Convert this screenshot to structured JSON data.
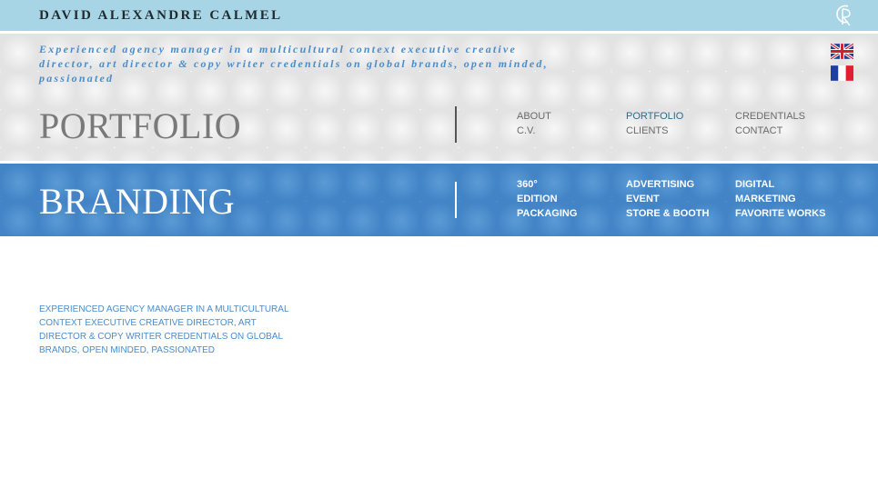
{
  "topbar": {
    "site_name": "DAVID ALEXANDRE CALMEL",
    "logo_icon": "dc-monogram-icon"
  },
  "header": {
    "tagline": "Experienced agency manager in a multicultural context executive creative director, art director & copy writer credentials on global brands, open minded, passionated",
    "languages": [
      {
        "icon": "uk-flag-icon"
      },
      {
        "icon": "french-flag-icon"
      }
    ],
    "section_title": "PORTFOLIO",
    "nav": {
      "about": "ABOUT",
      "cv": "C.V.",
      "portfolio": "PORTFOLIO",
      "clients": "CLIENTS",
      "credentials": "CREDENTIALS",
      "contact": "CONTACT"
    }
  },
  "branding": {
    "section_title": "BRANDING",
    "subnav": {
      "item_360": "360°",
      "edition": "EDITION",
      "packaging": "PACKAGING",
      "advertising": "ADVERTISING",
      "event": "EVENT",
      "store_booth": "STORE & BOOTH",
      "digital": "DIGITAL",
      "marketing": "MARKETING",
      "favorite_works": "FAVORITE WORKS"
    }
  },
  "main": {
    "intro": "EXPERIENCED AGENCY MANAGER IN A MULTICULTURAL CONTEXT EXECUTIVE CREATIVE DIRECTOR, ART DIRECTOR & COPY WRITER CREDENTIALS ON GLOBAL BRANDS, OPEN MINDED, PASSIONATED"
  },
  "colors": {
    "topbar": "#a8d5e5",
    "accent_blue": "#4a8dcc",
    "title_grey": "#7a7a7a",
    "nav_active": "#2d6b8f"
  }
}
